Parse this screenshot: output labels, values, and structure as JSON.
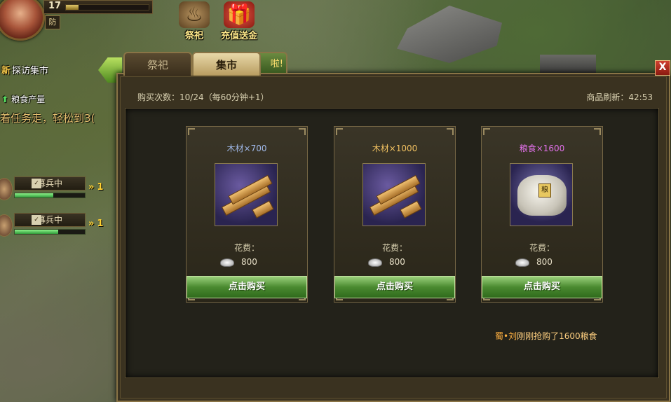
{
  "hud": {
    "level": "17",
    "level_progress": 0.15,
    "defense_badge": "防",
    "icons": [
      {
        "label": "祭祀",
        "icon": "incense-burner-icon"
      },
      {
        "label": "充值送金",
        "icon": "gift-box-icon"
      }
    ]
  },
  "quests": {
    "new_marker": "新",
    "new_text": "探访集市",
    "grain_text": "粮食产量",
    "task_text": "着任务走，轻松到3("
  },
  "recruit": [
    {
      "label": "募兵中",
      "progress": 0.55,
      "speed": "1"
    },
    {
      "label": "募兵中",
      "progress": 0.62,
      "speed": "1"
    }
  ],
  "dialog": {
    "tabs": [
      "祭祀",
      "集市"
    ],
    "hidden_tab_fragment": "啦!",
    "active_tab": "集市",
    "close_label": "X",
    "purchase_count_text": "购买次数：10/24（每60分钟+1）",
    "refresh_text": "商品刷新：42:53",
    "cost_label": "花费：",
    "buy_label": "点击购买",
    "items": [
      {
        "name": "木材×700",
        "name_color": "#9fb8e8",
        "image": "wood-planks-icon",
        "price": "800"
      },
      {
        "name": "木材×1000",
        "name_color": "#f0c060",
        "image": "wood-planks-icon",
        "price": "800"
      },
      {
        "name": "粮食×1600",
        "name_color": "#e070e8",
        "image": "grain-sack-icon",
        "price": "800"
      }
    ],
    "news": {
      "who": "蜀•刘",
      "text": "刚刚抢购了1600粮食"
    }
  }
}
